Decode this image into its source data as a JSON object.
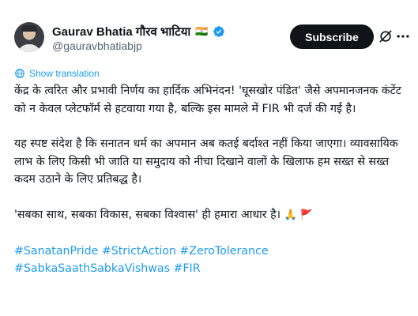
{
  "post": {
    "author": {
      "display_name": "Gaurav Bhatia गौरव भाटिया",
      "flag": "🇮🇳",
      "handle": "@gauravbhatiabjp",
      "verified_icon": "verified-badge-icon"
    },
    "actions": {
      "subscribe_label": "Subscribe",
      "grok_icon": "grok-icon",
      "more_icon": "more-icon"
    },
    "translate_label": "Show translation",
    "paragraphs": [
      "केंद्र के त्वरित और प्रभावी निर्णय का हार्दिक अभिनंदन! 'घूसखोर पंडित' जैसे अपमानजनक कंटेंट को न केवल प्लेटफॉर्म से हटवाया गया है, बल्कि इस मामले में FIR भी दर्ज की गई है।",
      "यह स्पष्ट संदेश है कि सनातन धर्म का अपमान अब कतई बर्दाश्त नहीं किया जाएगा। व्यावसायिक लाभ के लिए किसी भी जाति या समुदाय को नीचा दिखाने वालों के खिलाफ हम सख्त से सख्त कदम उठाने के लिए प्रतिबद्ध है।",
      "'सबका साथ, सबका विकास, सबका विश्वास' ही हमारा आधार है।"
    ],
    "closing_emojis": "🙏 🚩",
    "hashtags_line1": "#SanatanPride #StrictAction #ZeroTolerance",
    "hashtags_line2": "#SabkaSaathSabkaVishwas #FIR",
    "colors": {
      "text": "#0f1419",
      "secondary": "#536471",
      "link": "#1d9bf0",
      "button": "#0f1419"
    }
  }
}
